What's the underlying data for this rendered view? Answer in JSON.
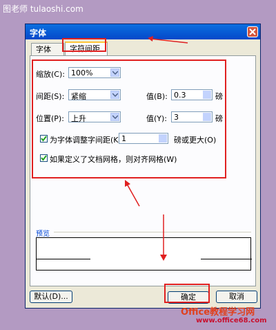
{
  "watermark_top": "图老师 tulaoshi.com",
  "watermark_bottom": {
    "line1": "Office教程学习网",
    "line2": "www.office68.com"
  },
  "dialog": {
    "title": "字体",
    "tabs": [
      {
        "label": "字体(N)"
      },
      {
        "label": "字符间距(R)"
      }
    ],
    "scale": {
      "label": "缩放(C):",
      "value": "100%"
    },
    "spacing": {
      "label": "间距(S):",
      "value": "紧缩",
      "value_label": "值(B):",
      "amount": "0.3",
      "unit": "磅"
    },
    "position": {
      "label": "位置(P):",
      "value": "上升",
      "value_label": "值(Y):",
      "amount": "3",
      "unit": "磅"
    },
    "kerning": {
      "label": "为字体调整字间距(K):",
      "amount": "1",
      "suffix": "磅或更大(O)",
      "checked": true
    },
    "snap_grid": {
      "label": "如果定义了文档网格，则对齐网格(W)",
      "checked": true
    },
    "preview_label": "预览",
    "buttons": {
      "default": "默认(D)...",
      "ok": "确定",
      "cancel": "取消"
    }
  },
  "colors": {
    "annotation": "#e02020",
    "titlebar": "#0548c9"
  }
}
